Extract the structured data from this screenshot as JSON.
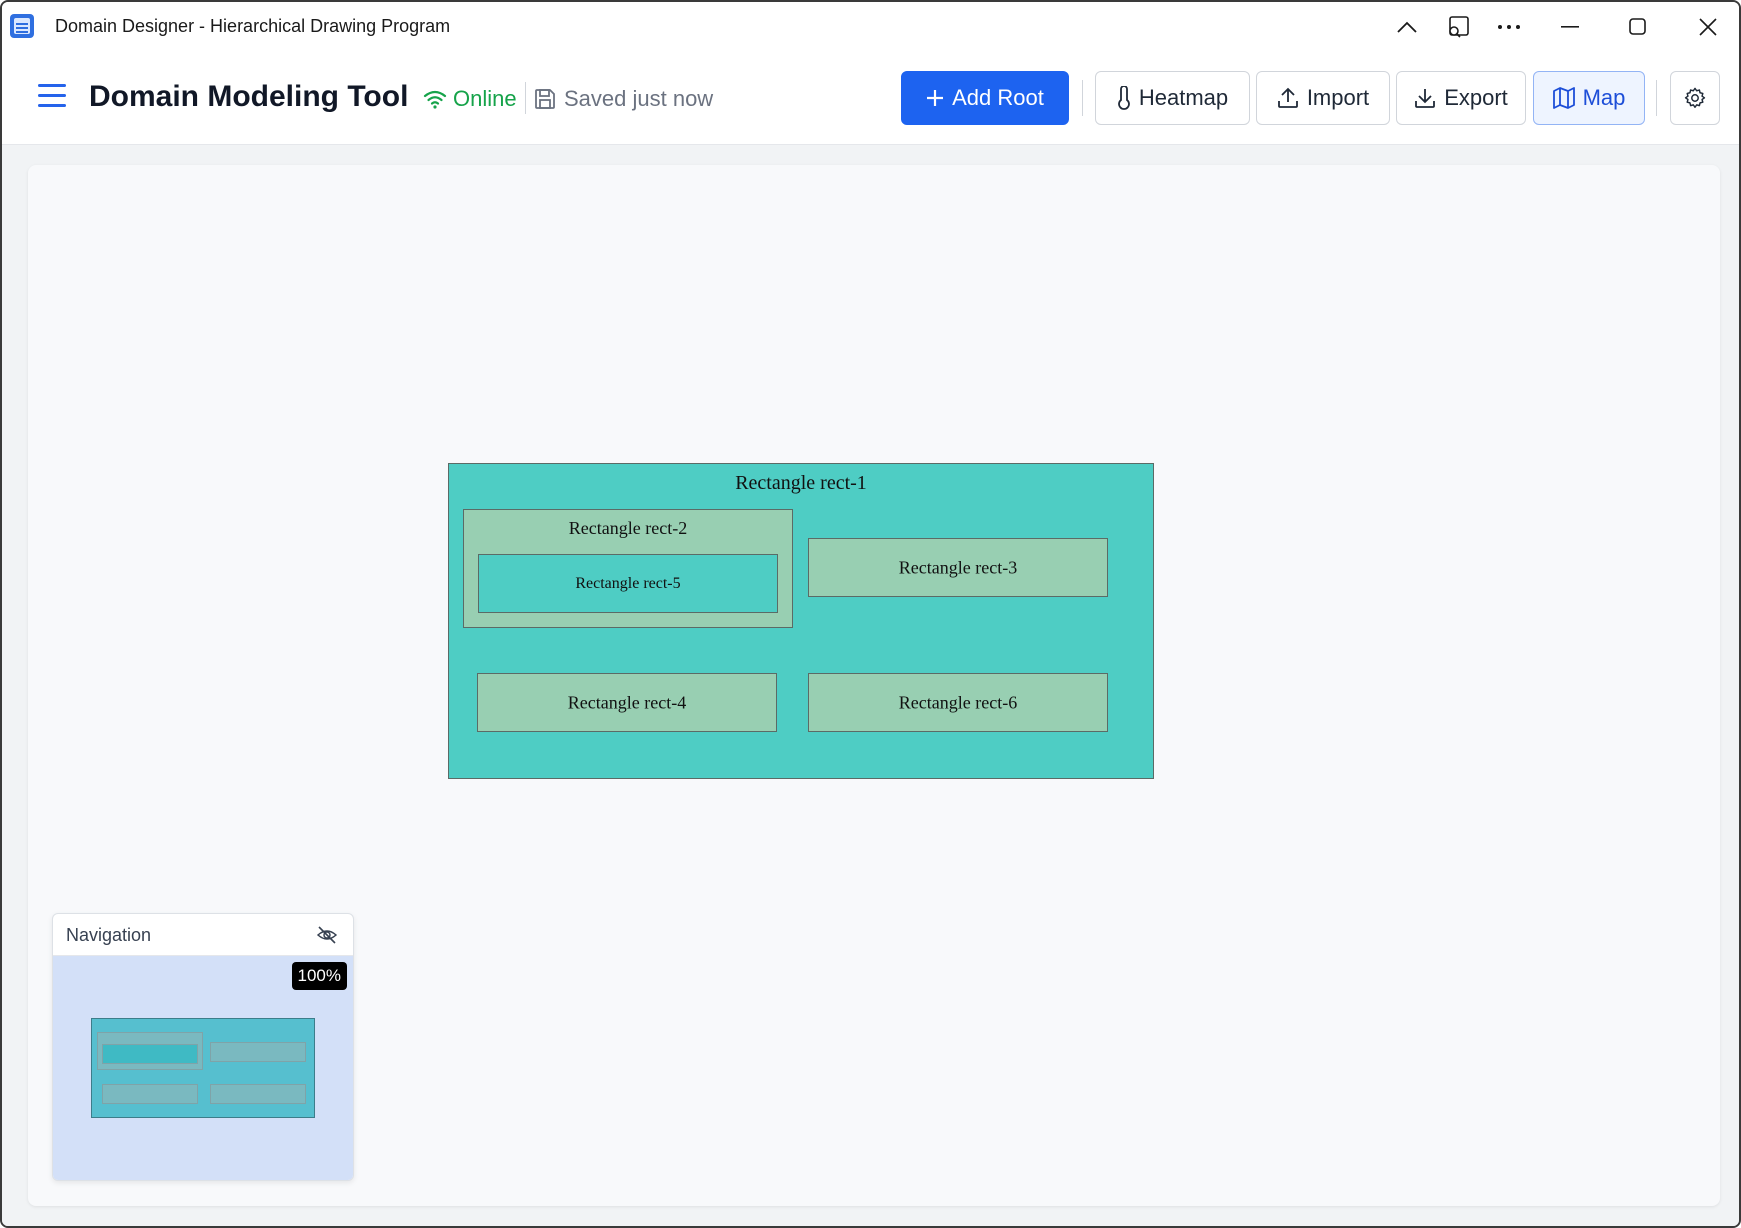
{
  "window": {
    "title": "Domain Designer - Hierarchical Drawing Program"
  },
  "header": {
    "app_title": "Domain Modeling Tool",
    "status": "Online",
    "saved_status": "Saved just now",
    "buttons": {
      "add_root": "Add Root",
      "heatmap": "Heatmap",
      "import": "Import",
      "export": "Export",
      "map": "Map"
    }
  },
  "canvas": {
    "rectangles": {
      "rect1": "Rectangle rect-1",
      "rect2": "Rectangle rect-2",
      "rect3": "Rectangle rect-3",
      "rect4": "Rectangle rect-4",
      "rect5": "Rectangle rect-5",
      "rect6": "Rectangle rect-6"
    }
  },
  "navigation": {
    "title": "Navigation",
    "zoom": "100%"
  },
  "colors": {
    "accent": "#1d63f0",
    "online": "#16a34a",
    "rect_teal": "#4ecdc4",
    "rect_sage": "#98cfb2"
  },
  "icons": [
    "app-icon",
    "chevron-up-icon",
    "cast-icon",
    "more-icon",
    "minimize-icon",
    "maximize-icon",
    "close-icon",
    "hamburger-icon",
    "wifi-icon",
    "save-icon",
    "plus-icon",
    "thermometer-icon",
    "upload-icon",
    "download-icon",
    "map-icon",
    "gear-icon",
    "eye-off-icon"
  ]
}
